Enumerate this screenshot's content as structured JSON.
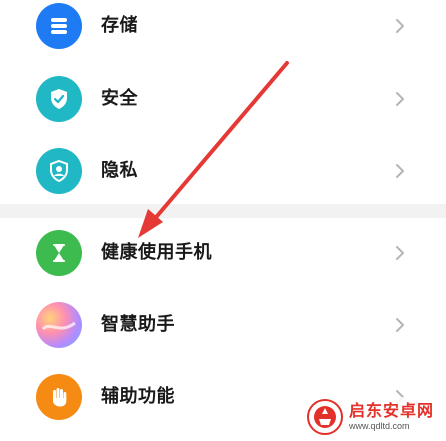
{
  "colors": {
    "storage_icon_bg": "#1e7bf3",
    "security_icon_bg": "#1fb8c4",
    "privacy_icon_bg": "#1fb8c4",
    "digital_balance_icon_bg": "#3dbb4f",
    "assistant_icon_bg": "#9a7bff",
    "accessibility_icon_bg": "#f68b14",
    "annotation_arrow": "#e53935",
    "chevron": "#b5b5b5"
  },
  "settings": {
    "group1": [
      {
        "label": "存储",
        "icon": "storage-icon"
      },
      {
        "label": "安全",
        "icon": "security-shield-icon"
      },
      {
        "label": "隐私",
        "icon": "privacy-icon"
      }
    ],
    "group2": [
      {
        "label": "健康使用手机",
        "icon": "hourglass-icon"
      },
      {
        "label": "智慧助手",
        "icon": "smart-assistant-icon"
      },
      {
        "label": "辅助功能",
        "icon": "hand-icon"
      }
    ]
  },
  "watermark": {
    "title": "启东安卓网",
    "url": "www.qdltd.com"
  }
}
